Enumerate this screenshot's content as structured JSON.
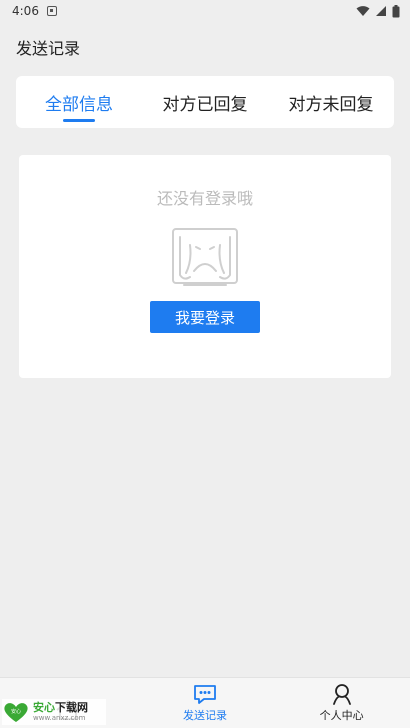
{
  "status": {
    "time": "4:06"
  },
  "page": {
    "title": "发送记录"
  },
  "tabs": [
    {
      "label": "全部信息",
      "active": true
    },
    {
      "label": "对方已回复",
      "active": false
    },
    {
      "label": "对方未回复",
      "active": false
    }
  ],
  "empty": {
    "message": "还没有登录哦",
    "login_button": "我要登录",
    "illustration": "crying-face-icon"
  },
  "bottom_nav": [
    {
      "label": "",
      "icon": "home-icon",
      "active": false
    },
    {
      "label": "发送记录",
      "icon": "message-icon",
      "active": true
    },
    {
      "label": "个人中心",
      "icon": "person-icon",
      "active": false
    }
  ],
  "watermark": {
    "main_green": "安心",
    "main_dark": "下载网",
    "sub": "www.anxz.com",
    "badge": "安心"
  },
  "colors": {
    "accent": "#1e7cf0",
    "background": "#eeeeee",
    "muted_text": "#bbbbbb"
  }
}
